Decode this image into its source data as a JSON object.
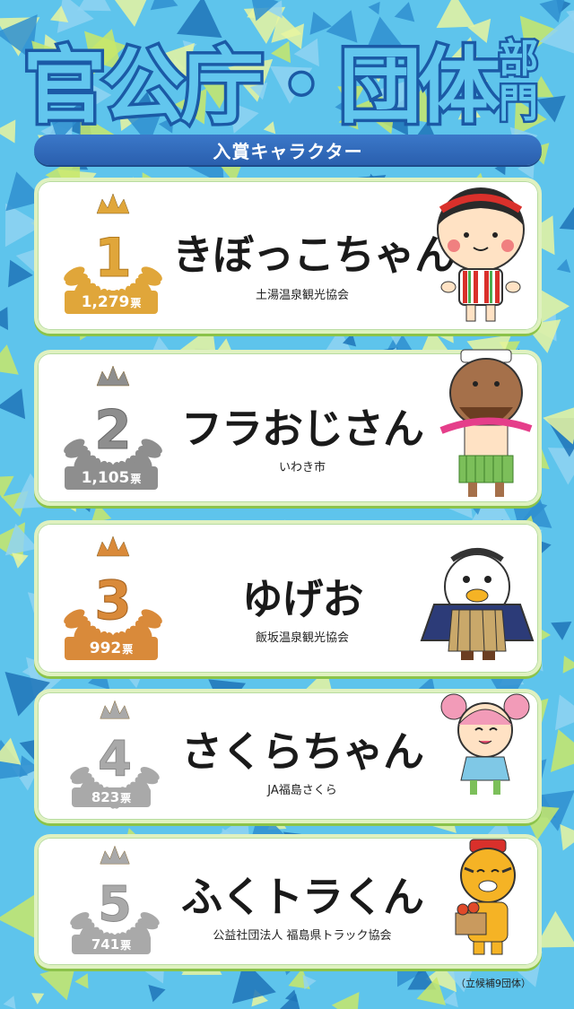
{
  "title": {
    "main": "官公庁・団体",
    "side": "部門"
  },
  "ribbon": "入賞キャラクター",
  "entries": [
    {
      "rank": "1",
      "votes": "1,279",
      "votes_unit": "票",
      "name": "きぼっこちゃん",
      "org": "土湯温泉観光協会",
      "medal_color": "#e0a63a",
      "mascot_icon": "kokeshi-mascot-icon"
    },
    {
      "rank": "2",
      "votes": "1,105",
      "votes_unit": "票",
      "name": "フラおじさん",
      "org": "いわき市",
      "medal_color": "#8e8e8e",
      "mascot_icon": "hula-man-mascot-icon"
    },
    {
      "rank": "3",
      "votes": "992",
      "votes_unit": "票",
      "name": "ゆげお",
      "org": "飯坂温泉観光協会",
      "medal_color": "#d98a3a",
      "mascot_icon": "steam-bird-mascot-icon"
    },
    {
      "rank": "4",
      "votes": "823",
      "votes_unit": "票",
      "name": "さくらちゃん",
      "org": "JA福島さくら",
      "medal_color": "#a9a9a9",
      "mascot_icon": "sakura-girl-mascot-icon"
    },
    {
      "rank": "5",
      "votes": "741",
      "votes_unit": "票",
      "name": "ふくトラくん",
      "org": "公益社団法人 福島県トラック協会",
      "medal_color": "#a9a9a9",
      "mascot_icon": "tiger-mascot-icon"
    }
  ],
  "footer": "（立候補9団体）"
}
